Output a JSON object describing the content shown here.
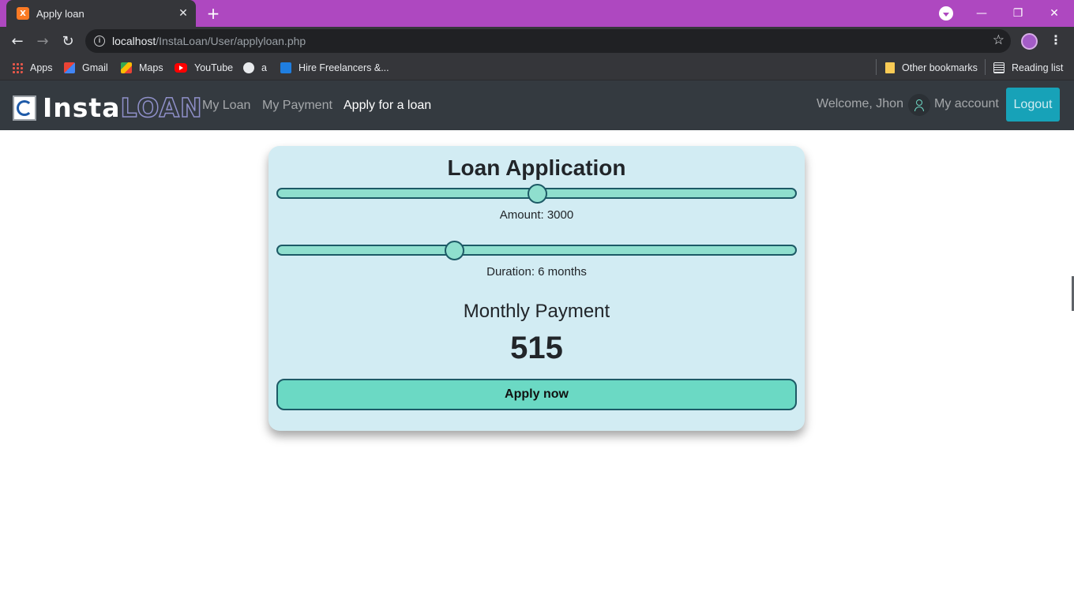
{
  "browser": {
    "tab_title": "Apply loan",
    "tab_favicon": "xampp-icon",
    "url_host": "localhost",
    "url_path": "/InstaLoan/User/applyloan.php",
    "theme_color": "#ae48c0",
    "bookmarks": [
      {
        "label": "Apps",
        "icon": "apps-icon"
      },
      {
        "label": "Gmail",
        "icon": "gmail-icon"
      },
      {
        "label": "Maps",
        "icon": "maps-icon"
      },
      {
        "label": "YouTube",
        "icon": "youtube-icon"
      },
      {
        "label": "a",
        "icon": "globe-icon"
      },
      {
        "label": "Hire Freelancers &...",
        "icon": "freelancer-icon"
      }
    ],
    "other_bookmarks": "Other bookmarks",
    "reading_list": "Reading list"
  },
  "navbar": {
    "brand_part1": "Insta",
    "brand_part2": "LOAN",
    "links": [
      "My Loan",
      "My Payment",
      "Apply for a loan"
    ],
    "active_link": "Apply for a loan",
    "welcome": "Welcome, Jhon",
    "account": "My account",
    "logout": "Logout",
    "logout_color": "#17a2b8"
  },
  "card": {
    "title": "Loan Application",
    "amount_label": "Amount: 3000",
    "amount_slider_fraction": 0.5,
    "duration_label": "Duration: 6 months",
    "duration_slider_fraction": 0.34,
    "monthly_title": "Monthly Payment",
    "monthly_value": "515",
    "apply_button": "Apply now",
    "card_bg": "#d2ecf3",
    "accent": "#6bd9c4"
  }
}
